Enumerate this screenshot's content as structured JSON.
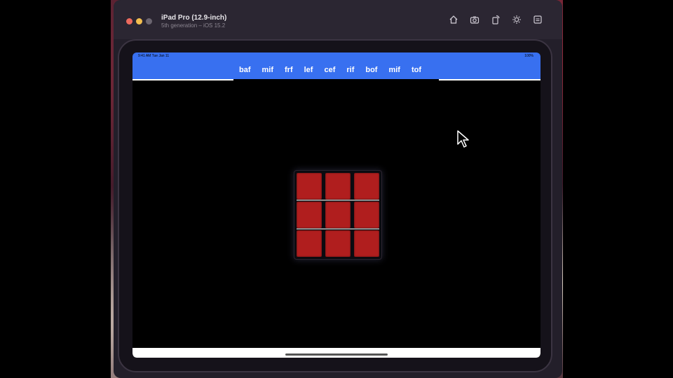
{
  "window": {
    "title": "iPad Pro (12.9-inch)",
    "subtitle": "5th generation – iOS 15.2",
    "toolbar_icons": [
      "home-icon",
      "camera-icon",
      "rotate-icon",
      "brightness-icon",
      "device-icon"
    ]
  },
  "statusbar": {
    "left": "9:41 AM  Tue Jan 11",
    "right": "100%"
  },
  "navbar": {
    "tabs": [
      {
        "label": "baf"
      },
      {
        "label": "mif"
      },
      {
        "label": "frf"
      },
      {
        "label": "lef"
      },
      {
        "label": "cef"
      },
      {
        "label": "rif"
      },
      {
        "label": "bof"
      },
      {
        "label": "mif"
      },
      {
        "label": "tof"
      }
    ]
  },
  "cube": {
    "face_color": "#b01e1e",
    "tiles": 9
  },
  "colors": {
    "navbar_bg": "#3870f0",
    "screen_bg": "#000000"
  }
}
